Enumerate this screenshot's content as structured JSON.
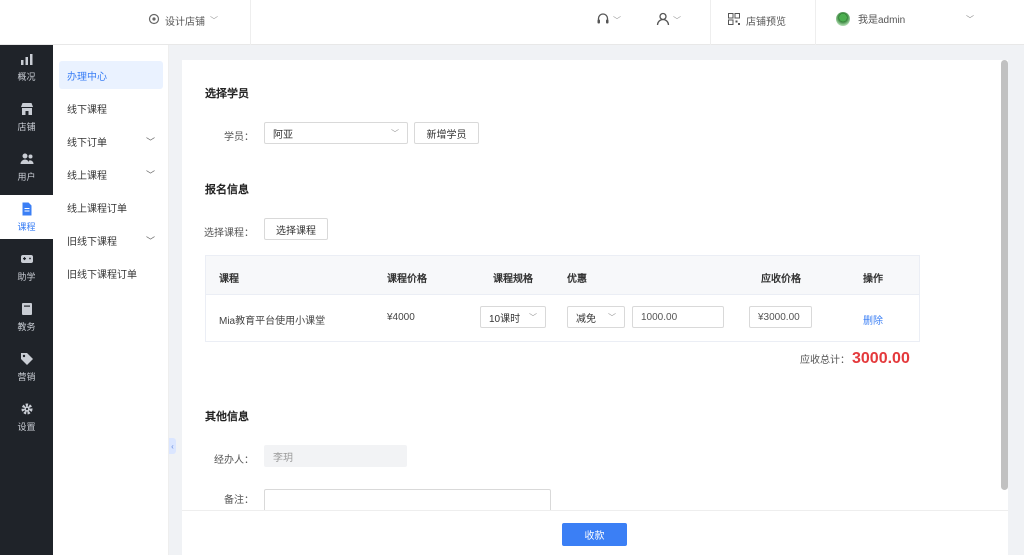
{
  "topbar": {
    "shop_switch_label": "设计店铺",
    "preview_label": "店铺预览",
    "account_name": "我是admin"
  },
  "sidenav": {
    "items": [
      {
        "label": "概况",
        "icon": "chart-icon"
      },
      {
        "label": "店铺",
        "icon": "store-icon"
      },
      {
        "label": "用户",
        "icon": "users-icon"
      },
      {
        "label": "课程",
        "icon": "document-icon",
        "active": true
      },
      {
        "label": "助学",
        "icon": "gamepad-icon"
      },
      {
        "label": "教务",
        "icon": "book-icon"
      },
      {
        "label": "营销",
        "icon": "tag-icon"
      },
      {
        "label": "设置",
        "icon": "gear-icon"
      }
    ]
  },
  "submenu": {
    "items": [
      {
        "label": "办理中心",
        "active": true,
        "expandable": false
      },
      {
        "label": "线下课程",
        "expandable": false
      },
      {
        "label": "线下订单",
        "expandable": true
      },
      {
        "label": "线上课程",
        "expandable": true
      },
      {
        "label": "线上课程订单",
        "expandable": false
      },
      {
        "label": "旧线下课程",
        "expandable": true
      },
      {
        "label": "旧线下课程订单",
        "expandable": false
      }
    ]
  },
  "student_section": {
    "title": "选择学员",
    "student_label": "学员：",
    "student_value": "阿亚",
    "add_student_button": "新增学员"
  },
  "signup_section": {
    "title": "报名信息",
    "course_label": "选择课程：",
    "course_button": "选择课程",
    "table": {
      "headers": [
        "课程",
        "课程价格",
        "课程规格",
        "优惠",
        "应收价格",
        "操作"
      ],
      "rows": [
        {
          "course": "Mia教育平台使用小课堂",
          "price": "¥4000",
          "spec": "10课时",
          "discount_type": "减免",
          "discount_value": "1000.00",
          "due_price": "¥3000.00",
          "action": "删除"
        }
      ]
    },
    "total_label": "应收总计：",
    "total_amount": "3000.00"
  },
  "other_section": {
    "title": "其他信息",
    "handler_label": "经办人：",
    "handler_value": "李玥",
    "remark_label": "备注："
  },
  "footer": {
    "submit_button": "收款"
  },
  "colors": {
    "primary": "#3b7ff5",
    "sidebar_bg": "#1f2329",
    "total_red": "#e4393c"
  }
}
